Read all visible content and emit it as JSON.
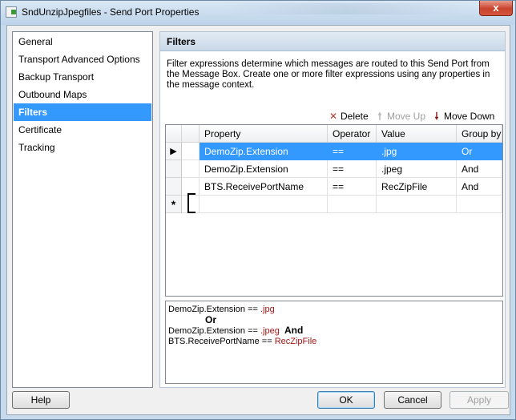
{
  "window": {
    "title": "SndUnzipJpegfiles - Send Port Properties",
    "close_label": "x"
  },
  "nav": {
    "items": [
      {
        "label": "General",
        "selected": false
      },
      {
        "label": "Transport Advanced Options",
        "selected": false
      },
      {
        "label": "Backup Transport",
        "selected": false
      },
      {
        "label": "Outbound Maps",
        "selected": false
      },
      {
        "label": "Filters",
        "selected": true
      },
      {
        "label": "Certificate",
        "selected": false
      },
      {
        "label": "Tracking",
        "selected": false
      }
    ]
  },
  "panel": {
    "title": "Filters",
    "description": "Filter expressions determine which messages are routed to this Send Port from the Message Box. Create one or more filter expressions using any properties in the message context."
  },
  "toolbar": {
    "delete_label": "Delete",
    "move_up_label": "Move Up",
    "move_down_label": "Move Down",
    "move_up_enabled": false
  },
  "grid": {
    "columns": [
      "Property",
      "Operator",
      "Value",
      "Group by"
    ],
    "rows": [
      {
        "property": "DemoZip.Extension",
        "operator": "==",
        "value": ".jpg",
        "group_by": "Or",
        "selected": true
      },
      {
        "property": "DemoZip.Extension",
        "operator": "==",
        "value": ".jpeg",
        "group_by": "And",
        "selected": false
      },
      {
        "property": "BTS.ReceivePortName",
        "operator": "==",
        "value": "RecZipFile",
        "group_by": "And",
        "selected": false
      }
    ],
    "new_row_marker": "*",
    "current_row_marker": "▶"
  },
  "preview": {
    "line1_property": "DemoZip.Extension",
    "line1_operator": "==",
    "line1_value": ".jpg",
    "or_label": "Or",
    "line2_property": "DemoZip.Extension",
    "line2_operator": "==",
    "line2_value": ".jpeg",
    "and_label": "And",
    "line3_property": "BTS.ReceivePortName",
    "line3_operator": "==",
    "line3_value": "RecZipFile"
  },
  "buttons": {
    "help": "Help",
    "ok": "OK",
    "cancel": "Cancel",
    "apply": "Apply",
    "apply_enabled": false
  },
  "colors": {
    "selection": "#3399ff",
    "preview_value": "#a31515",
    "delete_icon": "#c0392b",
    "move_down_icon": "#8b1a1a"
  }
}
